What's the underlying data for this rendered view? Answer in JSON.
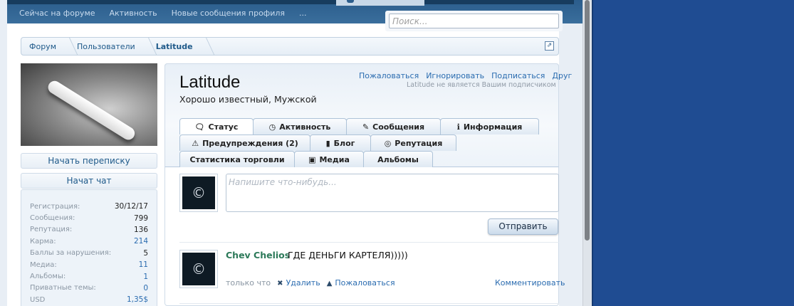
{
  "nav": {
    "links": [
      "Сейчас на форуме",
      "Активность",
      "Новые сообщения профиля",
      "..."
    ]
  },
  "search": {
    "placeholder": "Поиск..."
  },
  "breadcrumb": {
    "items": [
      "Форум",
      "Пользователи",
      "Latitude"
    ]
  },
  "sidebar": {
    "start_conversation": "Начать переписку",
    "start_chat": "Начат чат",
    "stats": [
      {
        "label": "Регистрация:",
        "value": "30/12/17",
        "link": false
      },
      {
        "label": "Сообщения:",
        "value": "799",
        "link": false
      },
      {
        "label": "Репутация:",
        "value": "136",
        "link": false
      },
      {
        "label": "Карма:",
        "value": "214",
        "link": true
      },
      {
        "label": "Баллы за нарушения:",
        "value": "5",
        "link": false
      },
      {
        "label": "Медиа:",
        "value": "11",
        "link": true
      },
      {
        "label": "Альбомы:",
        "value": "1",
        "link": true
      },
      {
        "label": "Приватные темы:",
        "value": "0",
        "link": true
      },
      {
        "label": "USD",
        "value": "1,35$",
        "link": true
      }
    ]
  },
  "profile": {
    "username": "Latitude",
    "user_title": "Хорошо известный, Мужской",
    "actions": [
      "Пожаловаться",
      "Игнорировать",
      "Подписаться",
      "Друг"
    ],
    "follow_note": "Latitude не является Вашим подписчиком"
  },
  "tabs": [
    {
      "label": "Статус",
      "icon": "chat-icon",
      "glyph": "🗨"
    },
    {
      "label": "Активность",
      "icon": "clock-icon",
      "glyph": "◷"
    },
    {
      "label": "Сообщения",
      "icon": "edit-icon",
      "glyph": "✎"
    },
    {
      "label": "Информация",
      "icon": "info-icon",
      "glyph": "ℹ"
    },
    {
      "label": "Предупреждения (2)",
      "icon": "warning-icon",
      "glyph": "⚠"
    },
    {
      "label": "Блог",
      "icon": "book-icon",
      "glyph": "▮"
    },
    {
      "label": "Репутация",
      "icon": "eye-icon",
      "glyph": "◎"
    },
    {
      "label": "Статистика торговли",
      "icon": "",
      "glyph": ""
    },
    {
      "label": "Медиа",
      "icon": "image-icon",
      "glyph": "▣"
    },
    {
      "label": "Альбомы",
      "icon": "",
      "glyph": ""
    }
  ],
  "status_form": {
    "placeholder": "Напишите что-нибудь...",
    "submit_label": "Отправить"
  },
  "post": {
    "author": "Chev Chelios",
    "text": "ГДЕ ДЕНЬГИ КАРТЕЛЯ)))))",
    "time": "только что",
    "delete_label": "Удалить",
    "report_label": "Пожаловаться",
    "comment_label": "Комментировать"
  },
  "avatar_glyph": "©"
}
